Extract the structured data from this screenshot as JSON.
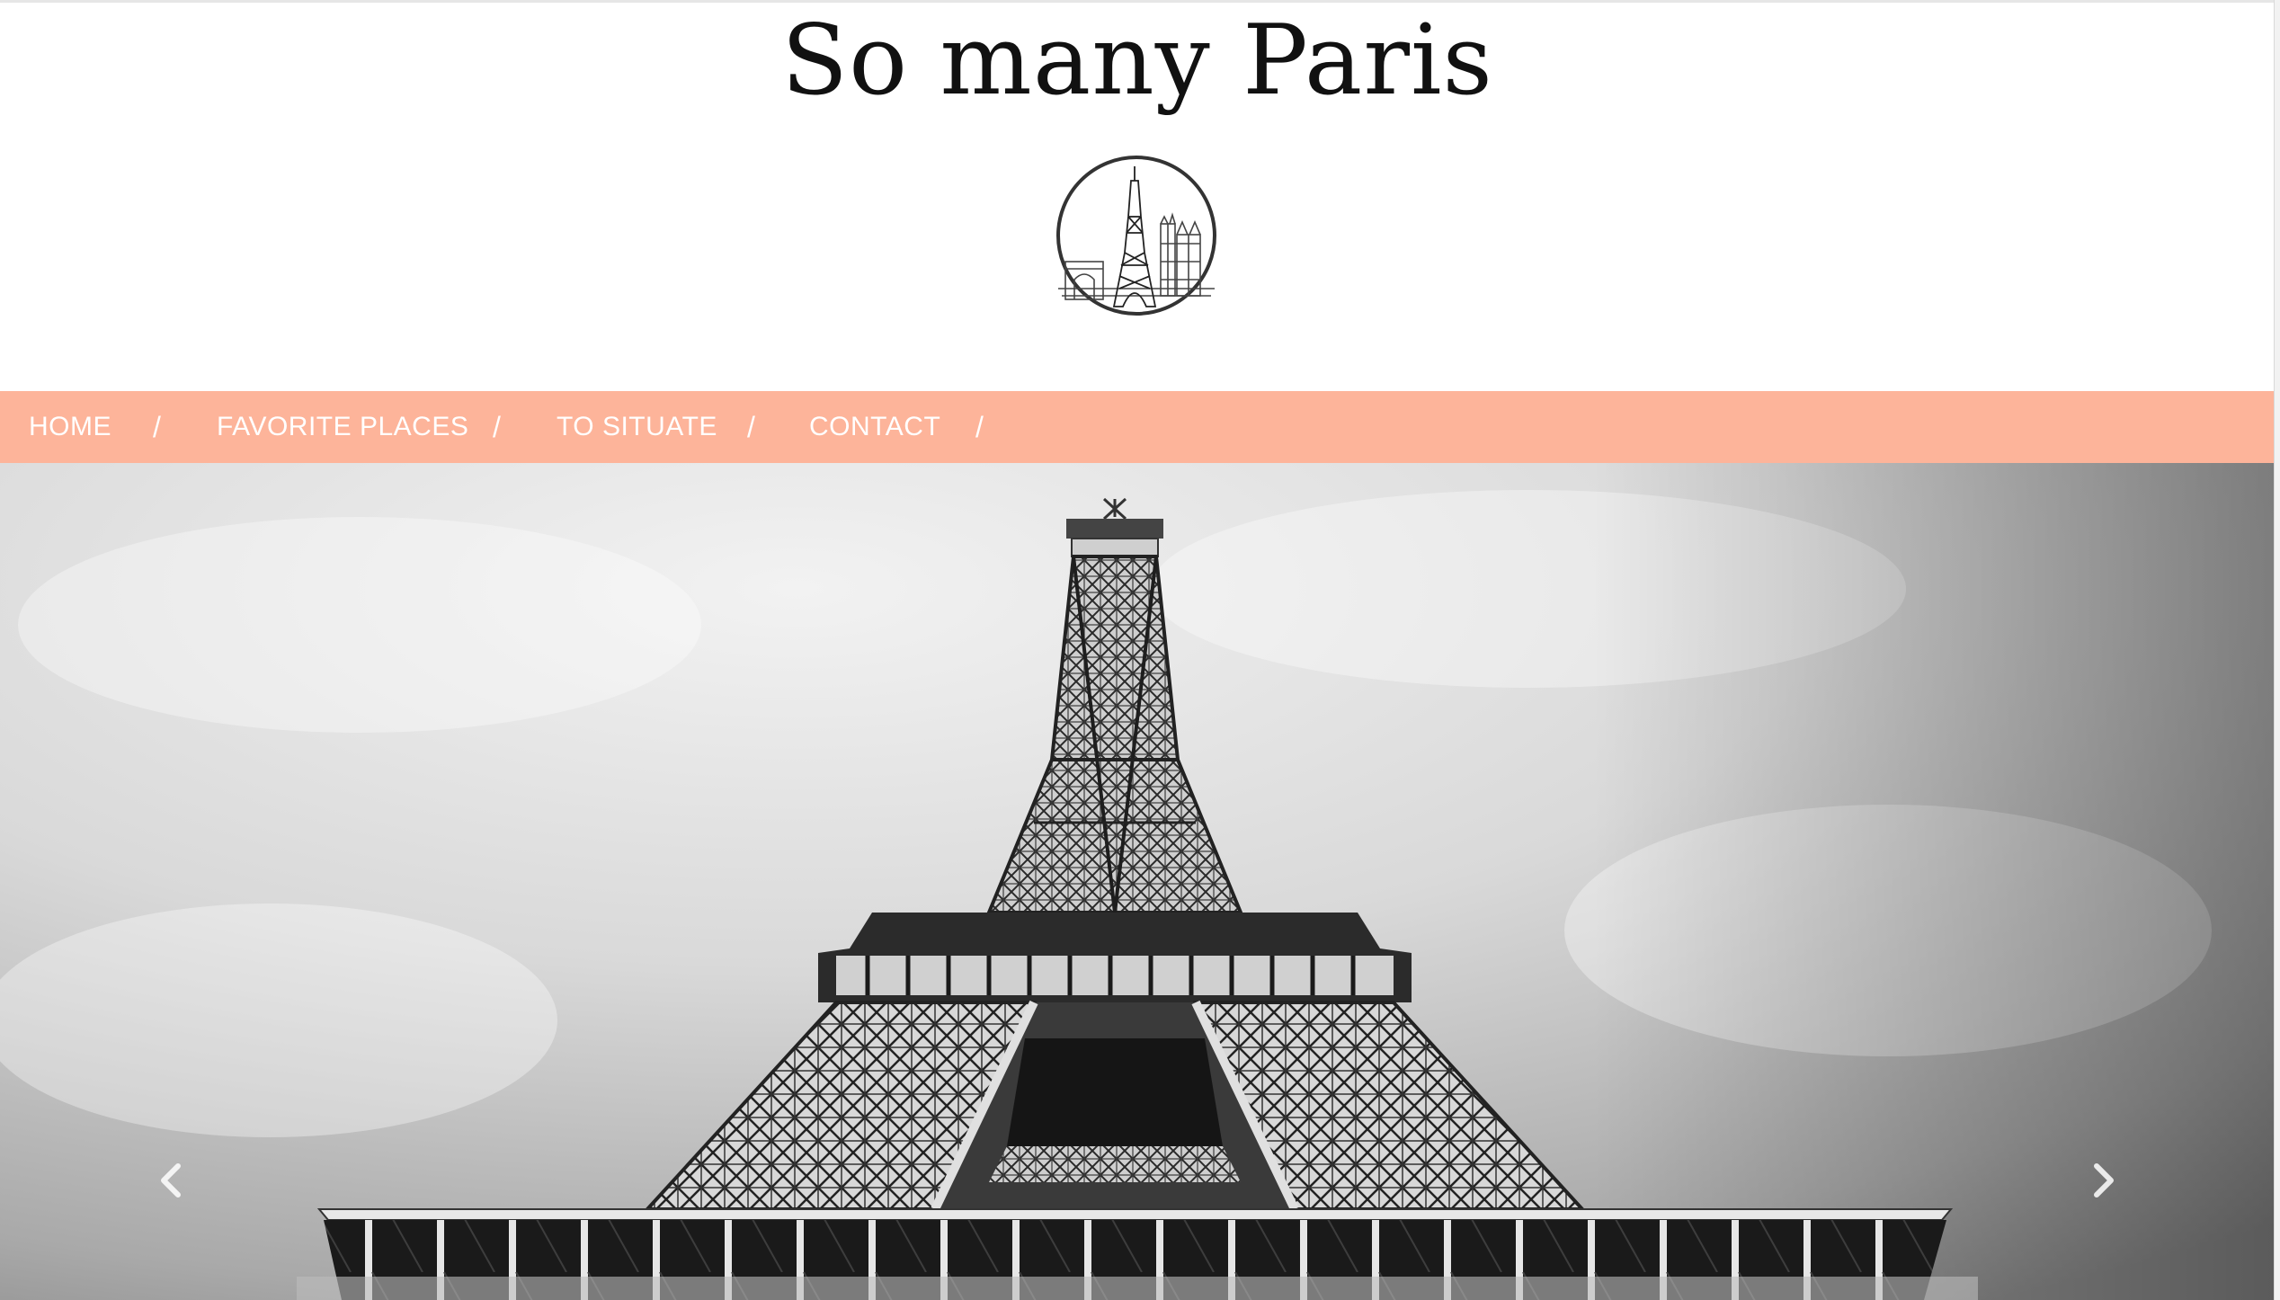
{
  "site": {
    "title": "So many Paris"
  },
  "logo": {
    "icon": "eiffel-skyline-logo"
  },
  "nav": {
    "items": [
      {
        "label": "HOME"
      },
      {
        "label": "FAVORITE PLACES"
      },
      {
        "label": "TO SITUATE"
      },
      {
        "label": "CONTACT"
      }
    ],
    "separator": "/"
  },
  "hero": {
    "image": "eiffel-tower-photo",
    "prev_icon": "chevron-left-icon",
    "next_icon": "chevron-right-icon"
  },
  "colors": {
    "nav_background": "#fdb49a",
    "nav_text": "#ffffff",
    "title_text": "#111111"
  }
}
